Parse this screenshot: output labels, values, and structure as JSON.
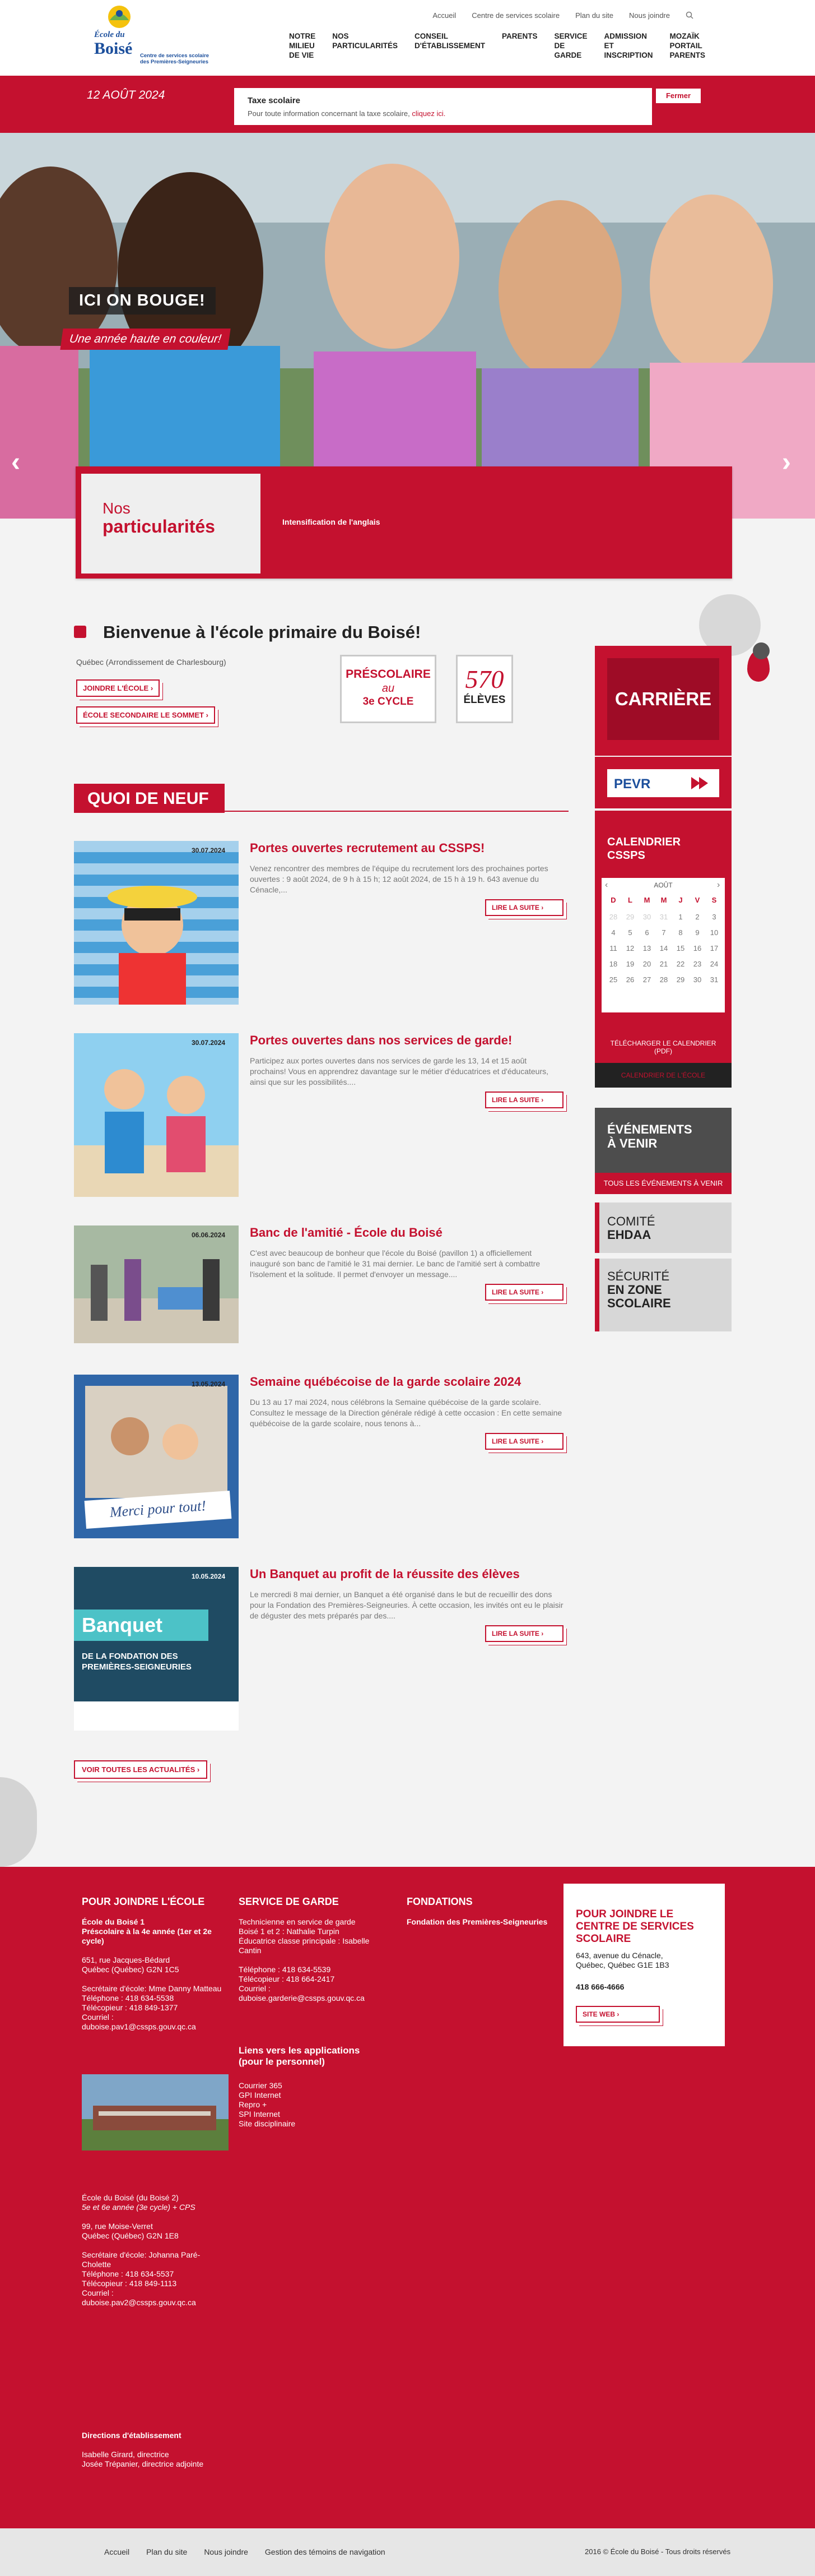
{
  "header": {
    "logo": {
      "line1": "École du",
      "line2": "Boisé",
      "sub": "Centre de services scolaire des Premières-Seigneuries"
    },
    "topnav": [
      "Accueil",
      "Centre de services scolaire",
      "Plan du site",
      "Nous joindre"
    ],
    "mainnav": [
      {
        "l1": "NOTRE",
        "l2": "MILIEU",
        "l3": "DE VIE"
      },
      {
        "l1": "NOS",
        "l2": "PARTICULARITÉS",
        "l3": ""
      },
      {
        "l1": "CONSEIL",
        "l2": "D'ÉTABLISSEMENT",
        "l3": ""
      },
      {
        "l1": "PARENTS",
        "l2": "",
        "l3": ""
      },
      {
        "l1": "SERVICE",
        "l2": "DE",
        "l3": "GARDE"
      },
      {
        "l1": "ADMISSION",
        "l2": "ET",
        "l3": "INSCRIPTION"
      },
      {
        "l1": "MOZAÏK",
        "l2": "PORTAIL",
        "l3": "PARENTS"
      }
    ]
  },
  "band": {
    "date": "12 AOÛT 2024",
    "notice_title": "Taxe scolaire",
    "notice_body": "Pour toute information concernant la taxe scolaire,",
    "notice_link": "cliquez ici.",
    "close": "Fermer"
  },
  "hero": {
    "title": "ICI ON BOUGE!",
    "subtitle": "Une année haute en couleur!"
  },
  "particularities": {
    "nos": "Nos",
    "part": "particularités",
    "item": "Intensification de l'anglais"
  },
  "welcome": {
    "title": "Bienvenue à l'école primaire du Boisé!",
    "location": "Québec (Arrondissement de Charlesbourg)",
    "btn1": "JOINDRE L'ÉCOLE",
    "btn2": "ÉCOLE SECONDAIRE LE SOMMET",
    "levels": {
      "a": "PRÉSCOLAIRE",
      "b": "au",
      "c": "3e CYCLE"
    },
    "students": {
      "count": "570",
      "label": "ÉLÈVES"
    }
  },
  "news": {
    "heading": "QUOI DE NEUF",
    "items": [
      {
        "date": "30.07.2024",
        "title": "Portes ouvertes recrutement au CSSPS!",
        "excerpt": "Venez rencontrer des membres de l'équipe du recrutement lors des prochaines portes ouvertes : 9 août 2024, de 9 h à 15 h; 12 août 2024, de 15 h à 19 h. 643 avenue du Cénacle,...",
        "more": "LIRE LA SUITE"
      },
      {
        "date": "30.07.2024",
        "title": "Portes ouvertes dans nos services de garde!",
        "excerpt": "Participez aux portes ouvertes dans nos services de garde les 13, 14 et 15 août prochains! Vous en apprendrez davantage sur le métier d'éducatrices et d'éducateurs, ainsi que sur les possibilités....",
        "more": "LIRE LA SUITE"
      },
      {
        "date": "06.06.2024",
        "title": "Banc de l'amitié - École du Boisé",
        "excerpt": "C'est avec beaucoup de bonheur que l'école du Boisé (pavillon 1) a officiellement inauguré son banc de l'amitié le 31 mai dernier. Le banc de l'amitié sert à combattre l'isolement et la solitude. Il permet d'envoyer un message....",
        "more": "LIRE LA SUITE"
      },
      {
        "date": "13.05.2024",
        "title": "Semaine québécoise de la garde scolaire 2024",
        "excerpt": "Du 13 au 17 mai 2024, nous célébrons la Semaine québécoise de la garde scolaire. Consultez le message de la Direction générale rédigé à cette occasion : En cette semaine québécoise de la garde scolaire, nous tenons à...",
        "more": "LIRE LA SUITE"
      },
      {
        "date": "10.05.2024",
        "title": "Un Banquet au profit de la réussite des élèves",
        "excerpt": "Le mercredi 8 mai dernier, un Banquet a été organisé dans le but de recueillir des dons pour la Fondation des Premières-Seigneuries. À cette occasion, les invités ont eu le plaisir de déguster des mets préparés par des....",
        "more": "LIRE LA SUITE"
      }
    ],
    "img4_text": "Merci pour tout!",
    "img5_title": "Banquet",
    "img5_sub": "DE LA FONDATION DES PREMIÈRES-SEIGNEURIES",
    "all": "VOIR TOUTES LES ACTUALITÉS"
  },
  "sidebar": {
    "career": "CARRIÈRE",
    "calendar_title": "CALENDRIER CSSPS",
    "calendar_month": "AOÛT",
    "calendar_days": [
      "D",
      "L",
      "M",
      "M",
      "J",
      "V",
      "S"
    ],
    "calendar_dates": [
      "28",
      "29",
      "30",
      "31",
      "1",
      "2",
      "3",
      "4",
      "5",
      "6",
      "7",
      "8",
      "9",
      "10",
      "11",
      "12",
      "13",
      "14",
      "15",
      "16",
      "17",
      "18",
      "19",
      "20",
      "21",
      "22",
      "23",
      "24",
      "25",
      "26",
      "27",
      "28",
      "29",
      "30",
      "31"
    ],
    "calendar_download": "TÉLÉCHARGER LE CALENDRIER (PDF)",
    "calendar_school": "CALENDRIER DE L'ÉCOLE",
    "events_title1": "ÉVÉNEMENTS",
    "events_title2": "À VENIR",
    "events_all": "TOUS LES ÉVÉNEMENTS À VENIR",
    "ehdaa1": "COMITÉ",
    "ehdaa2": "EHDAA",
    "secu1": "SÉCURITÉ",
    "secu2": "EN ZONE",
    "secu3": "SCOLAIRE"
  },
  "footer": {
    "col1_title": "POUR JOINDRE L'ÉCOLE",
    "school1_name": "École du Boisé 1",
    "school1_level": "Préscolaire à la 4e année (1er et 2e cycle)",
    "school1_addr": "651, rue Jacques-Bédard",
    "school1_city": "Québec (Québec) G2N 1C5",
    "school1_sec": "Secrétaire d'école: Mme Danny Matteau",
    "school1_tel": "Téléphone : 418 634-5538",
    "school1_fax": "Télécopieur : 418 849-1377",
    "school1_mail": "Courriel : duboise.pav1@cssps.gouv.qc.ca",
    "school2_name": "École du Boisé (du Boisé 2)",
    "school2_level": "5e et 6e année (3e cycle) + CPS",
    "school2_addr": "99, rue Moise-Verret",
    "school2_city": "Québec (Québec) G2N 1E8",
    "school2_sec": "Secrétaire d'école: Johanna Paré-Cholette",
    "school2_tel": "Téléphone : 418 634-5537",
    "school2_fax": "Télécopieur : 418 849-1113",
    "school2_mail": "Courriel : duboise.pav2@cssps.gouv.qc.ca",
    "dir_title": "Directions d'établissement",
    "dir1": "Isabelle Girard, directrice",
    "dir2": "Josée Trépanier, directrice adjointe",
    "col2_title": "SERVICE DE GARDE",
    "garde1": "Technicienne en service de garde",
    "garde2": "Boisé 1 et 2 : Nathalie Turpin",
    "garde3": "Éducatrice classe principale : Isabelle Cantin",
    "garde_tel": "Téléphone : 418 634-5539",
    "garde_fax": "Télécopieur : 418 664-2417",
    "garde_mail": "Courriel : duboise.garderie@cssps.gouv.qc.ca",
    "apps_title": "Liens vers les applications (pour le personnel)",
    "apps": [
      "Courrier 365",
      "GPI Internet",
      "Repro +",
      "SPI Internet",
      "Site disciplinaire"
    ],
    "col3_title": "FONDATIONS",
    "fond": "Fondation des Premières-Seigneuries",
    "card_title": "POUR JOINDRE LE CENTRE DE SERVICES SCOLAIRE",
    "card_addr1": "643, avenue du Cénacle,",
    "card_addr2": "Québec, Québec G1E 1B3",
    "card_tel": "418 666-4666",
    "card_web": "SITE WEB"
  },
  "bottom": {
    "nav": [
      "Accueil",
      "Plan du site",
      "Nous joindre",
      "Gestion des témoins de navigation"
    ],
    "copy": "2016 © École du Boisé - Tous droits réservés"
  },
  "colors": {
    "brand": "#c4112f",
    "dark": "#222222",
    "grey": "#4d4d4d"
  }
}
